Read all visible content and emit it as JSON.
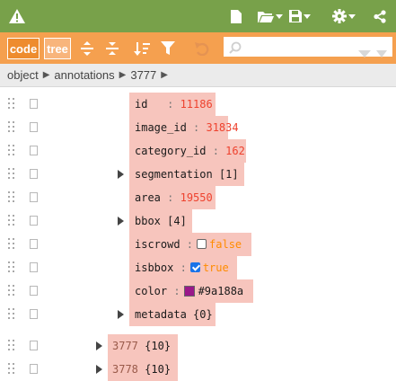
{
  "toolbar": {
    "code_label": "code",
    "tree_label": "tree",
    "search_placeholder": ""
  },
  "breadcrumb": [
    "object",
    "annotations",
    "3777"
  ],
  "fields": {
    "id": {
      "key": "id",
      "value": "11186"
    },
    "image_id": {
      "key": "image_id",
      "value": "31834"
    },
    "category_id": {
      "key": "category_id",
      "value": "162"
    },
    "segmentation": {
      "key": "segmentation",
      "count": "[1]"
    },
    "area": {
      "key": "area",
      "value": "19550"
    },
    "bbox": {
      "key": "bbox",
      "count": "[4]"
    },
    "iscrowd": {
      "key": "iscrowd",
      "value": "false"
    },
    "isbbox": {
      "key": "isbbox",
      "value": "true"
    },
    "color": {
      "key": "color",
      "value": "#9a188a"
    },
    "metadata": {
      "key": "metadata",
      "count": "{0}"
    }
  },
  "siblings": [
    {
      "key": "3777",
      "count": "{10}"
    },
    {
      "key": "3778",
      "count": "{10}"
    }
  ],
  "colors": {
    "header": "#78a14a",
    "toolbar": "#f5a04f",
    "highlight": "#f7c5bd",
    "number": "#ee422e",
    "boolean": "#ff8c00"
  },
  "icons": [
    "warning-icon",
    "new-document-icon",
    "open-folder-icon",
    "save-icon",
    "settings-icon",
    "share-icon",
    "expand-all-icon",
    "collapse-all-icon",
    "sort-icon",
    "filter-icon",
    "undo-icon",
    "search-icon"
  ]
}
